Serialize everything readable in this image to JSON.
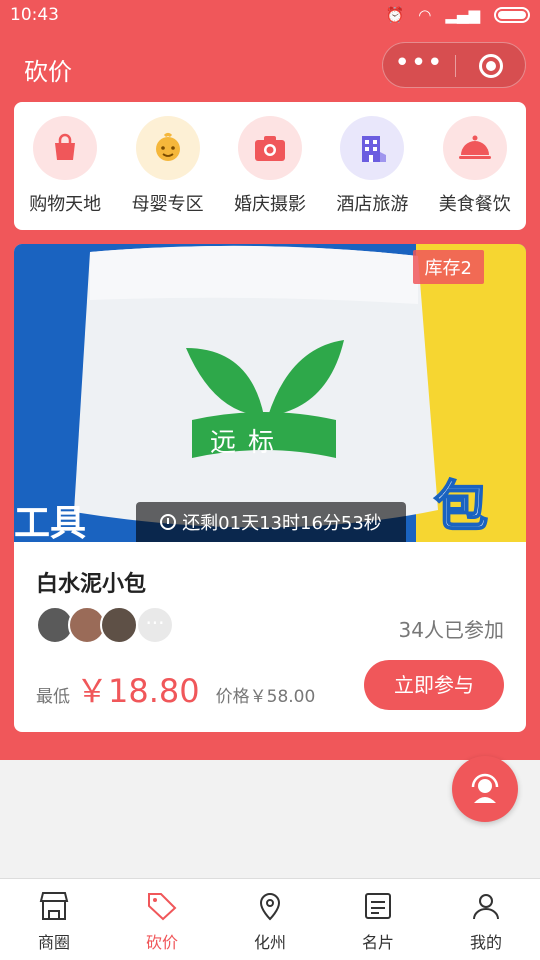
{
  "status_bar": {
    "time": "10:43"
  },
  "header": {
    "title": "砍价"
  },
  "categories": [
    {
      "label": "购物天地",
      "icon": "shopping-bag-icon",
      "bg": "#fde3e3",
      "color": "#f0575a"
    },
    {
      "label": "母婴专区",
      "icon": "baby-icon",
      "bg": "#fdf0d5",
      "color": "#f5b73b"
    },
    {
      "label": "婚庆摄影",
      "icon": "camera-icon",
      "bg": "#fde3e3",
      "color": "#f0575a"
    },
    {
      "label": "酒店旅游",
      "icon": "hotel-icon",
      "bg": "#e9e7fb",
      "color": "#6b5de0"
    },
    {
      "label": "美食餐饮",
      "icon": "food-cloche-icon",
      "bg": "#fde3e3",
      "color": "#f0575a"
    }
  ],
  "product": {
    "stock_label": "库存2",
    "countdown": "还剩01天13时16分53秒",
    "banner_left_text": "工具",
    "banner_right_text": "包邮",
    "brand_text": "远标",
    "name": "白水泥小包",
    "participants": "34人已参加",
    "min_price_label": "最低",
    "min_price": "￥18.80",
    "original_price": "价格￥58.00",
    "join_label": "立即参与"
  },
  "tabs": [
    {
      "label": "商圈",
      "icon": "store-icon"
    },
    {
      "label": "砍价",
      "icon": "price-tag-icon",
      "active": true
    },
    {
      "label": "化州",
      "icon": "location-icon"
    },
    {
      "label": "名片",
      "icon": "card-icon"
    },
    {
      "label": "我的",
      "icon": "user-icon"
    }
  ],
  "colors": {
    "accent": "#f0575a"
  }
}
